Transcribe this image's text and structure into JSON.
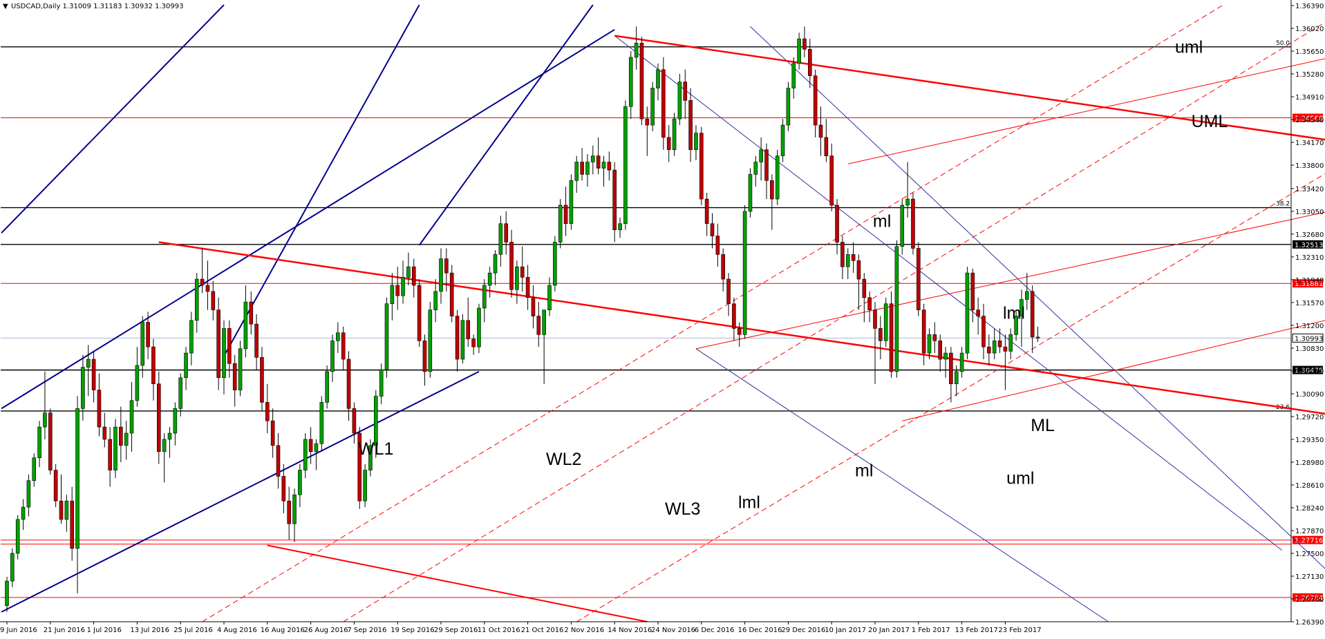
{
  "chart_data": {
    "type": "candlestick",
    "title": "USDCAD,Daily  1.31009 1.31183 1.30932 1.30993",
    "window_icon": "collapse-triangle-icon",
    "ylim": [
      1.2639,
      1.3639
    ],
    "y_ticks": [
      "1.36390",
      "1.36020",
      "1.35650",
      "1.35280",
      "1.34910",
      "1.34540",
      "1.34170",
      "1.33800",
      "1.33420",
      "1.33050",
      "1.32680",
      "1.32310",
      "1.31940",
      "1.31570",
      "1.31200",
      "1.30830",
      "1.30460",
      "1.30090",
      "1.29720",
      "1.29350",
      "1.28980",
      "1.28610",
      "1.28240",
      "1.27870",
      "1.27500",
      "1.27130",
      "1.26760",
      "1.26390"
    ],
    "x_ticks": [
      "9 Jun 2016",
      "21 Jun 2016",
      "1 Jul 2016",
      "13 Jul 2016",
      "25 Jul 2016",
      "4 Aug 2016",
      "16 Aug 2016",
      "26 Aug 2016",
      "7 Sep 2016",
      "19 Sep 2016",
      "29 Sep 2016",
      "11 Oct 2016",
      "21 Oct 2016",
      "2 Nov 2016",
      "14 Nov 2016",
      "24 Nov 2016",
      "6 Dec 2016",
      "16 Dec 2016",
      "29 Dec 2016",
      "10 Jan 2017",
      "20 Jan 2017",
      "1 Feb 2017",
      "13 Feb 2017",
      "23 Feb 2017"
    ],
    "x_tick_index": [
      0,
      8,
      16,
      24,
      32,
      40,
      48,
      56,
      64,
      72,
      80,
      88,
      96,
      104,
      112,
      120,
      128,
      136,
      144,
      152,
      160,
      168,
      176,
      184
    ],
    "horizontal_levels": [
      {
        "value": 1.3572,
        "color": "#000000",
        "fib": "50.0"
      },
      {
        "value": 1.34568,
        "color": "#ff0000",
        "tag": "1.34568"
      },
      {
        "value": 1.3311,
        "color": "#000000",
        "fib": "38.2"
      },
      {
        "value": 1.32513,
        "color": "#000000",
        "tag": "1.32513"
      },
      {
        "value": 1.31881,
        "color": "#ff0000",
        "tag": "1.31881"
      },
      {
        "value": 1.30993,
        "color": "#aab8d0",
        "tag": "1.30993"
      },
      {
        "value": 1.30475,
        "color": "#000000",
        "tag": "1.30475"
      },
      {
        "value": 1.2981,
        "color": "#000000",
        "fib": "23.6"
      },
      {
        "value": 1.27716,
        "color": "#ff0000",
        "tag": "1.27716"
      },
      {
        "value": 1.2765,
        "color": "#ff0000",
        "tag": ""
      },
      {
        "value": 1.26784,
        "color": "#ff0000",
        "tag": "1.26784"
      }
    ],
    "annotations": [
      {
        "text": "uml",
        "x": 0.8868,
        "y": 0.0827
      },
      {
        "text": "UML",
        "x": 0.8991,
        "y": 0.1989
      },
      {
        "text": "ml",
        "x": 0.6588,
        "y": 0.3553
      },
      {
        "text": "lml",
        "x": 0.7569,
        "y": 0.4989
      },
      {
        "text": "ML",
        "x": 0.7779,
        "y": 0.6745
      },
      {
        "text": "WL1",
        "x": 0.2702,
        "y": 0.7113
      },
      {
        "text": "WL2",
        "x": 0.4121,
        "y": 0.7276
      },
      {
        "text": "ml",
        "x": 0.6453,
        "y": 0.7452
      },
      {
        "text": "uml",
        "x": 0.7596,
        "y": 0.7571
      },
      {
        "text": "lml",
        "x": 0.5571,
        "y": 0.7949
      },
      {
        "text": "WL3",
        "x": 0.5018,
        "y": 0.8053
      }
    ],
    "candles": [
      [
        1.2665,
        1.2712,
        1.2655,
        1.2705
      ],
      [
        1.2705,
        1.2758,
        1.2695,
        1.275
      ],
      [
        1.275,
        1.2812,
        1.274,
        1.2805
      ],
      [
        1.2805,
        1.2838,
        1.2788,
        1.2825
      ],
      [
        1.2825,
        1.2878,
        1.281,
        1.2868
      ],
      [
        1.2868,
        1.2912,
        1.2858,
        1.2905
      ],
      [
        1.2905,
        1.2965,
        1.289,
        1.2955
      ],
      [
        1.2955,
        1.3045,
        1.2935,
        1.2978
      ],
      [
        1.2978,
        1.2985,
        1.2878,
        1.2885
      ],
      [
        1.2885,
        1.2895,
        1.2825,
        1.2835
      ],
      [
        1.2835,
        1.2878,
        1.2798,
        1.2805
      ],
      [
        1.2805,
        1.2845,
        1.2785,
        1.2835
      ],
      [
        1.2835,
        1.2858,
        1.2738,
        1.2758
      ],
      [
        1.2758,
        1.3005,
        1.2685,
        1.2985
      ],
      [
        1.2985,
        1.3072,
        1.2965,
        1.3052
      ],
      [
        1.3052,
        1.3088,
        1.3005,
        1.3065
      ],
      [
        1.3065,
        1.3078,
        1.2995,
        1.3015
      ],
      [
        1.3015,
        1.3042,
        1.294,
        1.2955
      ],
      [
        1.2955,
        1.2978,
        1.2922,
        1.2935
      ],
      [
        1.2935,
        1.2955,
        1.2858,
        1.2885
      ],
      [
        1.2885,
        1.2968,
        1.2872,
        1.2955
      ],
      [
        1.2955,
        1.2988,
        1.2898,
        1.2925
      ],
      [
        1.2925,
        1.2965,
        1.2902,
        1.2945
      ],
      [
        1.2945,
        1.3028,
        1.2915,
        1.2998
      ],
      [
        1.2998,
        1.3085,
        1.2988,
        1.3055
      ],
      [
        1.3055,
        1.3135,
        1.3035,
        1.3125
      ],
      [
        1.3125,
        1.3142,
        1.3065,
        1.3085
      ],
      [
        1.3085,
        1.3098,
        1.2998,
        1.3025
      ],
      [
        1.3025,
        1.3045,
        1.2895,
        1.2915
      ],
      [
        1.2915,
        1.2945,
        1.2865,
        1.2935
      ],
      [
        1.2935,
        1.2955,
        1.2905,
        1.2945
      ],
      [
        1.2945,
        1.2995,
        1.2925,
        1.2985
      ],
      [
        1.2985,
        1.3042,
        1.2972,
        1.3035
      ],
      [
        1.3035,
        1.3085,
        1.3015,
        1.3075
      ],
      [
        1.3075,
        1.3142,
        1.3055,
        1.3128
      ],
      [
        1.3128,
        1.3205,
        1.3108,
        1.3195
      ],
      [
        1.3195,
        1.3245,
        1.3172,
        1.3185
      ],
      [
        1.3185,
        1.3225,
        1.3145,
        1.3175
      ],
      [
        1.3175,
        1.3192,
        1.3128,
        1.3145
      ],
      [
        1.3145,
        1.3165,
        1.3015,
        1.3035
      ],
      [
        1.3035,
        1.3128,
        1.3008,
        1.3115
      ],
      [
        1.3115,
        1.3128,
        1.3035,
        1.3058
      ],
      [
        1.3058,
        1.3072,
        1.2988,
        1.3015
      ],
      [
        1.3015,
        1.3095,
        1.3005,
        1.3082
      ],
      [
        1.3082,
        1.3185,
        1.3068,
        1.3158
      ],
      [
        1.3158,
        1.3175,
        1.3105,
        1.3122
      ],
      [
        1.3122,
        1.3138,
        1.3048,
        1.3068
      ],
      [
        1.3068,
        1.3085,
        1.2982,
        1.2995
      ],
      [
        1.2995,
        1.3025,
        1.2945,
        1.2965
      ],
      [
        1.2965,
        1.2985,
        1.2905,
        1.2925
      ],
      [
        1.2925,
        1.2945,
        1.2855,
        1.2875
      ],
      [
        1.2875,
        1.2895,
        1.2815,
        1.2835
      ],
      [
        1.2835,
        1.2858,
        1.2772,
        1.2798
      ],
      [
        1.2798,
        1.2855,
        1.2768,
        1.2845
      ],
      [
        1.2845,
        1.2895,
        1.2825,
        1.2885
      ],
      [
        1.2885,
        1.2945,
        1.2872,
        1.2935
      ],
      [
        1.2935,
        1.2955,
        1.2895,
        1.2915
      ],
      [
        1.2915,
        1.2935,
        1.2885,
        1.2928
      ],
      [
        1.2928,
        1.3005,
        1.2915,
        1.2995
      ],
      [
        1.2995,
        1.3055,
        1.2985,
        1.3045
      ],
      [
        1.3045,
        1.3105,
        1.3028,
        1.3095
      ],
      [
        1.3095,
        1.3125,
        1.3075,
        1.3108
      ],
      [
        1.3108,
        1.3118,
        1.3048,
        1.3065
      ],
      [
        1.3065,
        1.3078,
        1.2965,
        1.2985
      ],
      [
        1.2985,
        1.2995,
        1.2928,
        1.2945
      ],
      [
        1.2945,
        1.2955,
        1.2822,
        1.2835
      ],
      [
        1.2835,
        1.2895,
        1.2825,
        1.2885
      ],
      [
        1.2885,
        1.2935,
        1.2875,
        1.2925
      ],
      [
        1.2925,
        1.3015,
        1.2905,
        1.3005
      ],
      [
        1.3005,
        1.3058,
        1.2992,
        1.3048
      ],
      [
        1.3048,
        1.3165,
        1.3035,
        1.3155
      ],
      [
        1.3155,
        1.3205,
        1.3128,
        1.3185
      ],
      [
        1.3185,
        1.3215,
        1.3145,
        1.3168
      ],
      [
        1.3168,
        1.3225,
        1.3155,
        1.3198
      ],
      [
        1.3198,
        1.3238,
        1.3185,
        1.3215
      ],
      [
        1.3215,
        1.3228,
        1.3165,
        1.3185
      ],
      [
        1.3185,
        1.3195,
        1.3085,
        1.3095
      ],
      [
        1.3095,
        1.3105,
        1.3022,
        1.3045
      ],
      [
        1.3045,
        1.3158,
        1.3035,
        1.3145
      ],
      [
        1.3145,
        1.3195,
        1.3125,
        1.3175
      ],
      [
        1.3175,
        1.3245,
        1.3155,
        1.3228
      ],
      [
        1.3228,
        1.3245,
        1.3175,
        1.3205
      ],
      [
        1.3205,
        1.3218,
        1.3125,
        1.3135
      ],
      [
        1.3135,
        1.3145,
        1.3045,
        1.3065
      ],
      [
        1.3065,
        1.3138,
        1.3058,
        1.3128
      ],
      [
        1.3128,
        1.3165,
        1.3085,
        1.3098
      ],
      [
        1.3098,
        1.3105,
        1.3072,
        1.3085
      ],
      [
        1.3085,
        1.3155,
        1.3075,
        1.3148
      ],
      [
        1.3148,
        1.3195,
        1.3125,
        1.3185
      ],
      [
        1.3185,
        1.3215,
        1.3165,
        1.3205
      ],
      [
        1.3205,
        1.3242,
        1.3185,
        1.3235
      ],
      [
        1.3235,
        1.3298,
        1.3215,
        1.3285
      ],
      [
        1.3285,
        1.3305,
        1.3235,
        1.3255
      ],
      [
        1.3255,
        1.3275,
        1.3165,
        1.3178
      ],
      [
        1.3178,
        1.3225,
        1.3155,
        1.3215
      ],
      [
        1.3215,
        1.3248,
        1.3175,
        1.3198
      ],
      [
        1.3198,
        1.3218,
        1.3145,
        1.3165
      ],
      [
        1.3165,
        1.3185,
        1.3115,
        1.3135
      ],
      [
        1.3135,
        1.3158,
        1.3085,
        1.3105
      ],
      [
        1.3105,
        1.3118,
        1.3025,
        1.3145
      ],
      [
        1.3145,
        1.3198,
        1.3135,
        1.3185
      ],
      [
        1.3185,
        1.3265,
        1.3175,
        1.3255
      ],
      [
        1.3255,
        1.3325,
        1.3245,
        1.3315
      ],
      [
        1.3315,
        1.3345,
        1.3265,
        1.3285
      ],
      [
        1.3285,
        1.3365,
        1.3275,
        1.3355
      ],
      [
        1.3355,
        1.3395,
        1.3335,
        1.3385
      ],
      [
        1.3385,
        1.3408,
        1.3355,
        1.3365
      ],
      [
        1.3365,
        1.3398,
        1.3345,
        1.3385
      ],
      [
        1.3385,
        1.3412,
        1.3365,
        1.3395
      ],
      [
        1.3395,
        1.3425,
        1.3365,
        1.3375
      ],
      [
        1.3375,
        1.3395,
        1.3345,
        1.3385
      ],
      [
        1.3385,
        1.3402,
        1.3355,
        1.3372
      ],
      [
        1.3372,
        1.3385,
        1.3255,
        1.3275
      ],
      [
        1.3275,
        1.3295,
        1.3262,
        1.3285
      ],
      [
        1.3285,
        1.3485,
        1.3275,
        1.3475
      ],
      [
        1.3475,
        1.3565,
        1.3455,
        1.3555
      ],
      [
        1.3555,
        1.3605,
        1.3535,
        1.3578
      ],
      [
        1.3578,
        1.3588,
        1.3445,
        1.3455
      ],
      [
        1.3455,
        1.3475,
        1.3395,
        1.3445
      ],
      [
        1.3445,
        1.3515,
        1.3435,
        1.3505
      ],
      [
        1.3505,
        1.3545,
        1.3485,
        1.3535
      ],
      [
        1.3535,
        1.3555,
        1.3405,
        1.3425
      ],
      [
        1.3425,
        1.3445,
        1.3385,
        1.3405
      ],
      [
        1.3405,
        1.3465,
        1.3395,
        1.3455
      ],
      [
        1.3455,
        1.3528,
        1.3445,
        1.3515
      ],
      [
        1.3515,
        1.3535,
        1.3455,
        1.3485
      ],
      [
        1.3485,
        1.3505,
        1.3385,
        1.3405
      ],
      [
        1.3405,
        1.3445,
        1.3388,
        1.3432
      ],
      [
        1.3432,
        1.3442,
        1.3315,
        1.3325
      ],
      [
        1.3325,
        1.3335,
        1.3265,
        1.3285
      ],
      [
        1.3285,
        1.3302,
        1.3245,
        1.3265
      ],
      [
        1.3265,
        1.3285,
        1.3215,
        1.3235
      ],
      [
        1.3235,
        1.3245,
        1.3175,
        1.3195
      ],
      [
        1.3195,
        1.3205,
        1.3135,
        1.3155
      ],
      [
        1.3155,
        1.3165,
        1.3095,
        1.3115
      ],
      [
        1.3115,
        1.3125,
        1.3085,
        1.3105
      ],
      [
        1.3105,
        1.3315,
        1.3098,
        1.3305
      ],
      [
        1.3305,
        1.3375,
        1.3295,
        1.3365
      ],
      [
        1.3365,
        1.3395,
        1.3345,
        1.3385
      ],
      [
        1.3385,
        1.3425,
        1.3355,
        1.3405
      ],
      [
        1.3405,
        1.3415,
        1.3325,
        1.3355
      ],
      [
        1.3355,
        1.3365,
        1.3275,
        1.3325
      ],
      [
        1.3325,
        1.3405,
        1.3315,
        1.3395
      ],
      [
        1.3395,
        1.3455,
        1.3385,
        1.3445
      ],
      [
        1.3445,
        1.3515,
        1.3435,
        1.3505
      ],
      [
        1.3505,
        1.3555,
        1.3488,
        1.3545
      ],
      [
        1.3545,
        1.3595,
        1.3535,
        1.3585
      ],
      [
        1.3585,
        1.3605,
        1.3555,
        1.3568
      ],
      [
        1.3568,
        1.3585,
        1.3505,
        1.3525
      ],
      [
        1.3525,
        1.3535,
        1.3425,
        1.3445
      ],
      [
        1.3445,
        1.3475,
        1.3395,
        1.3425
      ],
      [
        1.3425,
        1.3455,
        1.3385,
        1.3395
      ],
      [
        1.3395,
        1.3415,
        1.3305,
        1.3315
      ],
      [
        1.3315,
        1.3325,
        1.3235,
        1.3255
      ],
      [
        1.3255,
        1.3265,
        1.3195,
        1.3215
      ],
      [
        1.3215,
        1.3245,
        1.3195,
        1.3235
      ],
      [
        1.3235,
        1.3255,
        1.3205,
        1.3225
      ],
      [
        1.3225,
        1.3235,
        1.3145,
        1.3195
      ],
      [
        1.3195,
        1.3205,
        1.3125,
        1.3165
      ],
      [
        1.3165,
        1.3175,
        1.3125,
        1.3145
      ],
      [
        1.3145,
        1.3158,
        1.3025,
        1.3115
      ],
      [
        1.3115,
        1.3135,
        1.3065,
        1.3095
      ],
      [
        1.3095,
        1.3165,
        1.3085,
        1.3155
      ],
      [
        1.3155,
        1.3175,
        1.3035,
        1.3045
      ],
      [
        1.3045,
        1.3258,
        1.3035,
        1.3248
      ],
      [
        1.3248,
        1.3325,
        1.3235,
        1.3315
      ],
      [
        1.3315,
        1.3385,
        1.3295,
        1.3325
      ],
      [
        1.3325,
        1.3335,
        1.3235,
        1.3245
      ],
      [
        1.3245,
        1.3255,
        1.3135,
        1.3145
      ],
      [
        1.3145,
        1.3155,
        1.3055,
        1.3075
      ],
      [
        1.3075,
        1.3115,
        1.3065,
        1.3105
      ],
      [
        1.3105,
        1.3125,
        1.3075,
        1.3095
      ],
      [
        1.3095,
        1.3105,
        1.3045,
        1.3065
      ],
      [
        1.3065,
        1.3085,
        1.3035,
        1.3075
      ],
      [
        1.3075,
        1.3085,
        1.2995,
        1.3025
      ],
      [
        1.3025,
        1.3055,
        1.3005,
        1.3045
      ],
      [
        1.3045,
        1.3085,
        1.3035,
        1.3075
      ],
      [
        1.3075,
        1.3215,
        1.3065,
        1.3205
      ],
      [
        1.3205,
        1.3212,
        1.3125,
        1.3145
      ],
      [
        1.3145,
        1.3165,
        1.3105,
        1.3135
      ],
      [
        1.3135,
        1.3155,
        1.3065,
        1.3085
      ],
      [
        1.3085,
        1.3105,
        1.3055,
        1.3075
      ],
      [
        1.3075,
        1.3115,
        1.3065,
        1.3095
      ],
      [
        1.3095,
        1.3115,
        1.3075,
        1.3085
      ],
      [
        1.3085,
        1.3105,
        1.3015,
        1.3078
      ],
      [
        1.3078,
        1.3115,
        1.3065,
        1.3105
      ],
      [
        1.3105,
        1.3145,
        1.3095,
        1.3135
      ],
      [
        1.3135,
        1.3178,
        1.3085,
        1.3162
      ],
      [
        1.3162,
        1.3205,
        1.3145,
        1.3175
      ],
      [
        1.3175,
        1.3185,
        1.3075,
        1.3101
      ],
      [
        1.3101,
        1.3118,
        1.3093,
        1.30993
      ]
    ]
  },
  "colors": {
    "bull": "#00a000",
    "bear": "#c00000",
    "blue_channel": "#00008b",
    "red_fork": "#ff0000",
    "tag_bg_red": "#ff0000",
    "tag_bg_black": "#000000"
  }
}
